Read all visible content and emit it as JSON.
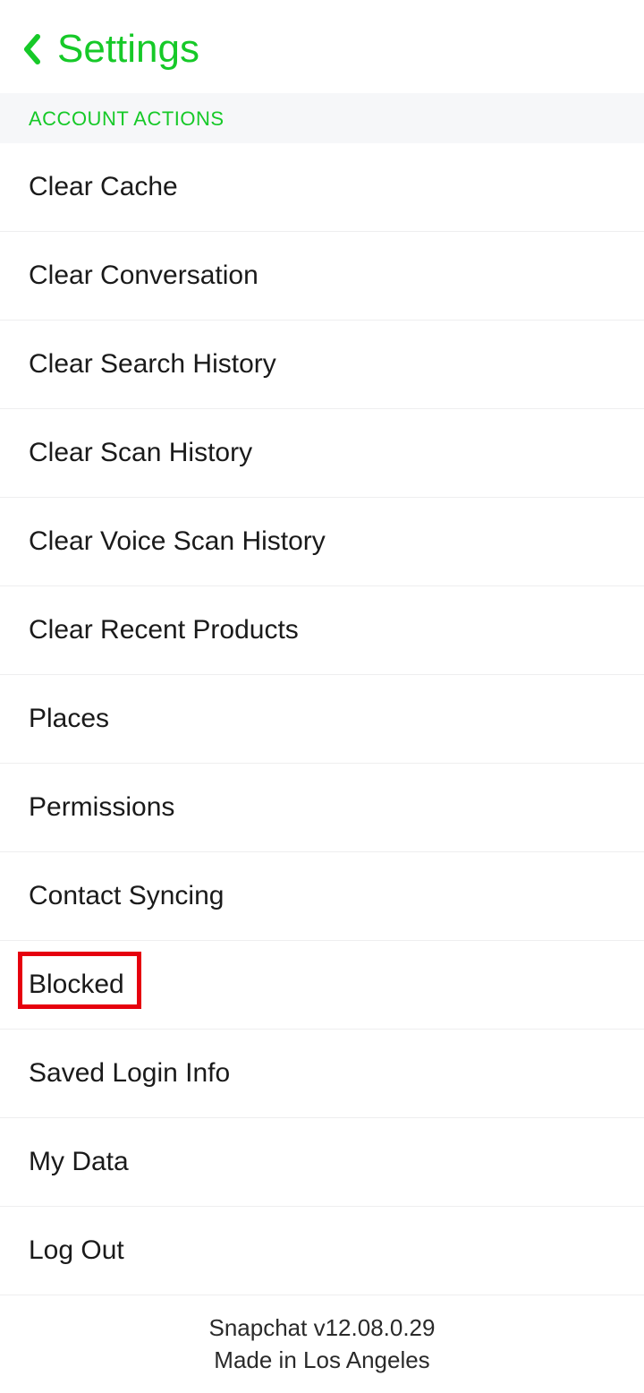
{
  "header": {
    "title": "Settings"
  },
  "section": {
    "title": "ACCOUNT ACTIONS"
  },
  "items": [
    {
      "label": "Clear Cache"
    },
    {
      "label": "Clear Conversation"
    },
    {
      "label": "Clear Search History"
    },
    {
      "label": "Clear Scan History"
    },
    {
      "label": "Clear Voice Scan History"
    },
    {
      "label": "Clear Recent Products"
    },
    {
      "label": "Places"
    },
    {
      "label": "Permissions"
    },
    {
      "label": "Contact Syncing"
    },
    {
      "label": "Blocked",
      "highlighted": true
    },
    {
      "label": "Saved Login Info"
    },
    {
      "label": "My Data"
    },
    {
      "label": "Log Out"
    }
  ],
  "footer": {
    "version": "Snapchat v12.08.0.29",
    "made_in": "Made in Los Angeles"
  }
}
